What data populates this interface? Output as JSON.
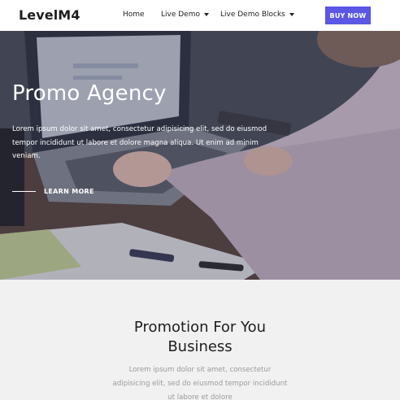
{
  "header": {
    "logo": "LevelM4",
    "nav": [
      {
        "label": "Home",
        "has_caret": false
      },
      {
        "label": "Live Demo",
        "has_caret": true
      },
      {
        "label": "Live Demo Blocks",
        "has_caret": true
      }
    ],
    "buy_button": "BUY NOW",
    "colors": {
      "accent": "#5b56e4"
    }
  },
  "hero": {
    "title": "Promo Agency",
    "text": "Lorem ipsum dolor sit amet, consectetur adipisicing elit, sed do eiusmod tempor incididunt ut labore et dolore magna aliqua. Ut enim ad minim veniam.",
    "cta": "LEARN MORE"
  },
  "section": {
    "title": "Promotion For You Business",
    "text": "Lorem ipsum dolor sit amet, consectetur adipisicing elit, sed do eiusmod tempor incididunt ut labore et dolore"
  }
}
